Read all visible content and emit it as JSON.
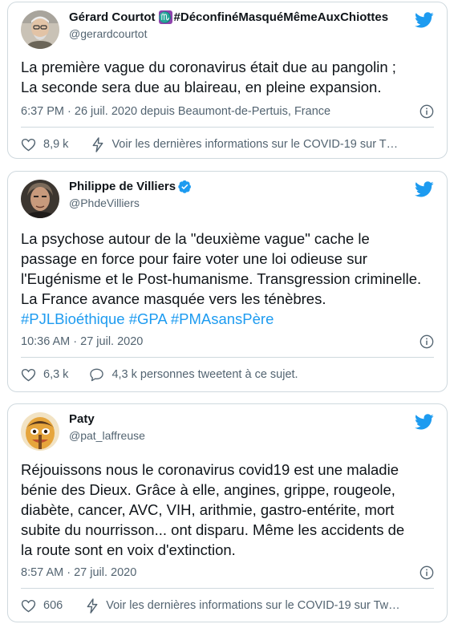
{
  "tweets": [
    {
      "name": "Gérard Courtot",
      "name_suffix": "#DéconfinéMasquéMêmeAuxChiottes",
      "zodiac_glyph": "♏",
      "handle": "@gerardcourtot",
      "body_lines": [
        "La première vague du coronavirus était due au pangolin ;",
        "La seconde sera due au blaireau, en pleine expansion."
      ],
      "meta": "6:37 PM · 26 juil. 2020 depuis Beaumont-de-Pertuis, France",
      "likes": "8,9 k",
      "secondary_action": "Voir les dernières informations sur le COVID-19 sur T…"
    },
    {
      "name": "Philippe de Villiers",
      "verified": true,
      "handle": "@PhdeVilliers",
      "body_lines": [
        "La psychose autour de la \"deuxième vague\" cache le",
        "passage en force pour faire voter une loi odieuse sur",
        "l'Eugénisme et le Post-humanisme. Transgression criminelle.",
        "La France avance masquée vers les ténèbres."
      ],
      "hashtags": "#PJLBioéthique #GPA #PMAsansPère",
      "meta": "10:36 AM · 27 juil. 2020",
      "likes": "6,3 k",
      "secondary_action": "4,3 k personnes tweetent à ce sujet."
    },
    {
      "name": "Paty",
      "handle": "@pat_laffreuse",
      "body_lines": [
        "Réjouissons nous le coronavirus covid19 est une maladie",
        "bénie des Dieux. Grâce à elle, angines, grippe, rougeole,",
        "diabète, cancer, AVC, VIH, arithmie, gastro-entérite, mort",
        "subite du nourrisson... ont disparu. Même les accidents de",
        "la route sont en voix d'extinction."
      ],
      "meta": "8:57 AM · 27 juil. 2020",
      "likes": "606",
      "secondary_action": "Voir les dernières informations sur le COVID-19 sur Tw…"
    }
  ],
  "colors": {
    "twitter_blue": "#1d9bf0",
    "text": "#0f1419",
    "secondary_text": "#536471",
    "border": "#cfd9de",
    "zodiac_badge": "#8e44ad"
  },
  "icons": {
    "logo": "twitter-bird-icon",
    "info": "info-icon",
    "like": "heart-icon",
    "covid_info": "lightning-icon",
    "reply": "speech-bubble-icon",
    "verified": "verified-badge-icon"
  }
}
